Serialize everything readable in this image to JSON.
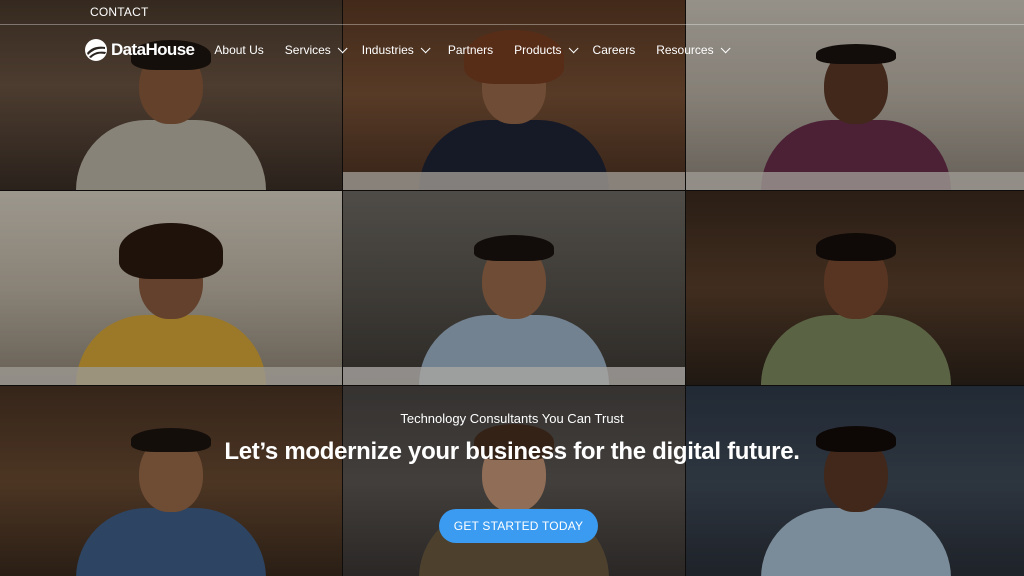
{
  "topbar": {
    "contact_label": "CONTACT"
  },
  "brand": {
    "name": "DataHouse",
    "logo_icon": "datahouse-logo-icon"
  },
  "nav": {
    "items": [
      {
        "label": "About Us",
        "has_dropdown": false
      },
      {
        "label": "Services",
        "has_dropdown": true
      },
      {
        "label": "Industries",
        "has_dropdown": true
      },
      {
        "label": "Partners",
        "has_dropdown": false
      },
      {
        "label": "Products",
        "has_dropdown": true
      },
      {
        "label": "Careers",
        "has_dropdown": false
      },
      {
        "label": "Resources",
        "has_dropdown": true
      }
    ]
  },
  "hero": {
    "tagline": "Technology Consultants You Can Trust",
    "headline": "Let’s modernize your business for the digital future.",
    "cta_label": "GET STARTED TODAY"
  },
  "colors": {
    "accent": "#3a9bf0",
    "text": "#ffffff"
  }
}
